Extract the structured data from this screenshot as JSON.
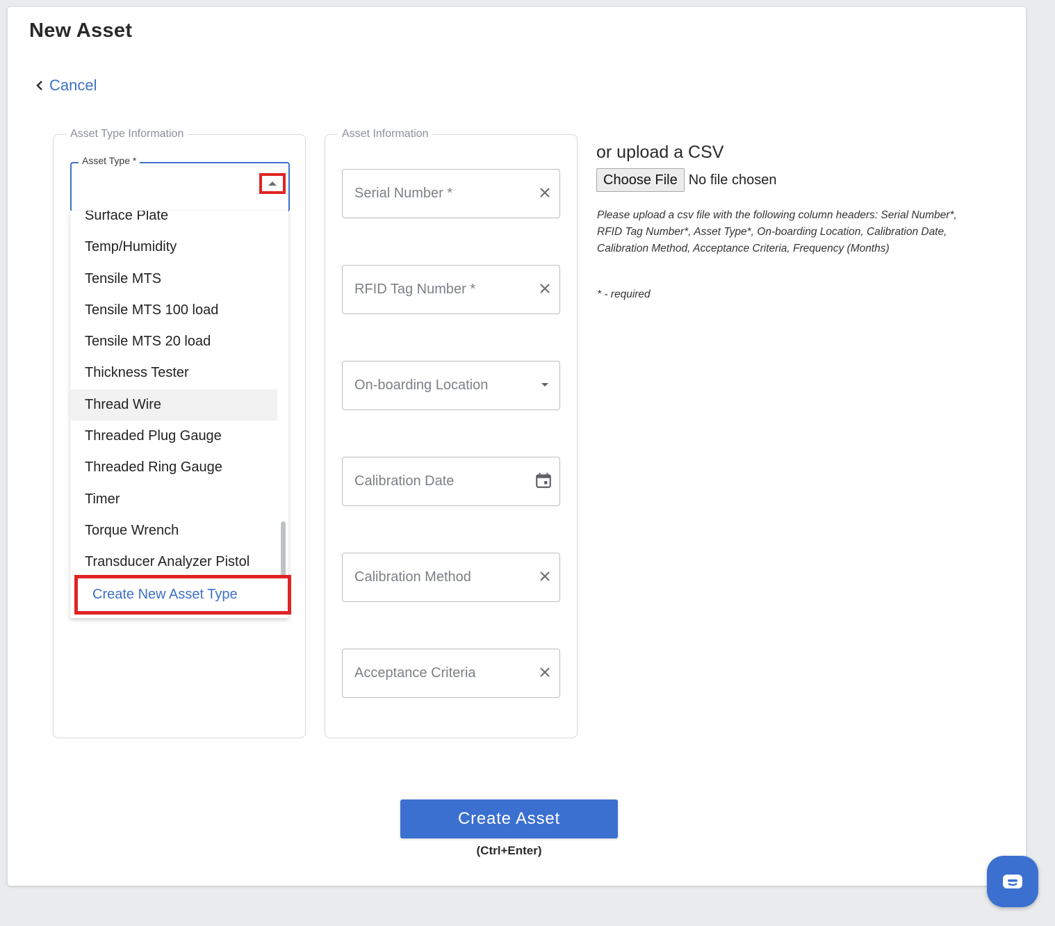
{
  "header": {
    "title": "New Asset",
    "cancel_label": "Cancel"
  },
  "asset_type_section": {
    "legend": "Asset Type Information",
    "select_label": "Asset Type *",
    "select_value": "",
    "dropdown_items": [
      "Surface Plate",
      "Temp/Humidity",
      "Tensile MTS",
      "Tensile MTS 100 load",
      "Tensile MTS 20 load",
      "Thickness Tester",
      "Thread Wire",
      "Threaded Plug Gauge",
      "Threaded Ring Gauge",
      "Timer",
      "Torque Wrench",
      "Transducer Analyzer Pistol"
    ],
    "hovered_item": "Thread Wire",
    "create_new_label": "Create New Asset Type"
  },
  "asset_info_section": {
    "legend": "Asset Information",
    "fields": [
      {
        "placeholder": "Serial Number *",
        "icon": "clear-icon"
      },
      {
        "placeholder": "RFID Tag Number *",
        "icon": "clear-icon"
      },
      {
        "placeholder": "On-boarding Location",
        "icon": "dropdown-arrow-icon"
      },
      {
        "placeholder": "Calibration Date",
        "icon": "calendar-icon"
      },
      {
        "placeholder": "Calibration Method",
        "icon": "clear-icon"
      },
      {
        "placeholder": "Acceptance Criteria",
        "icon": "clear-icon"
      }
    ]
  },
  "csv_section": {
    "title": "or upload a CSV",
    "choose_file_label": "Choose File",
    "file_status": "No file chosen",
    "help_text": "Please upload a csv file with the following column headers: Serial Number*, RFID Tag Number*, Asset Type*, On-boarding Location, Calibration Date, Calibration Method, Acceptance Criteria, Frequency (Months)",
    "required_note": "* - required"
  },
  "actions": {
    "create_label": "Create Asset",
    "shortcut_hint": "(Ctrl+Enter)"
  },
  "colors": {
    "accent": "#3c70d0",
    "highlight_border": "#e02424"
  }
}
